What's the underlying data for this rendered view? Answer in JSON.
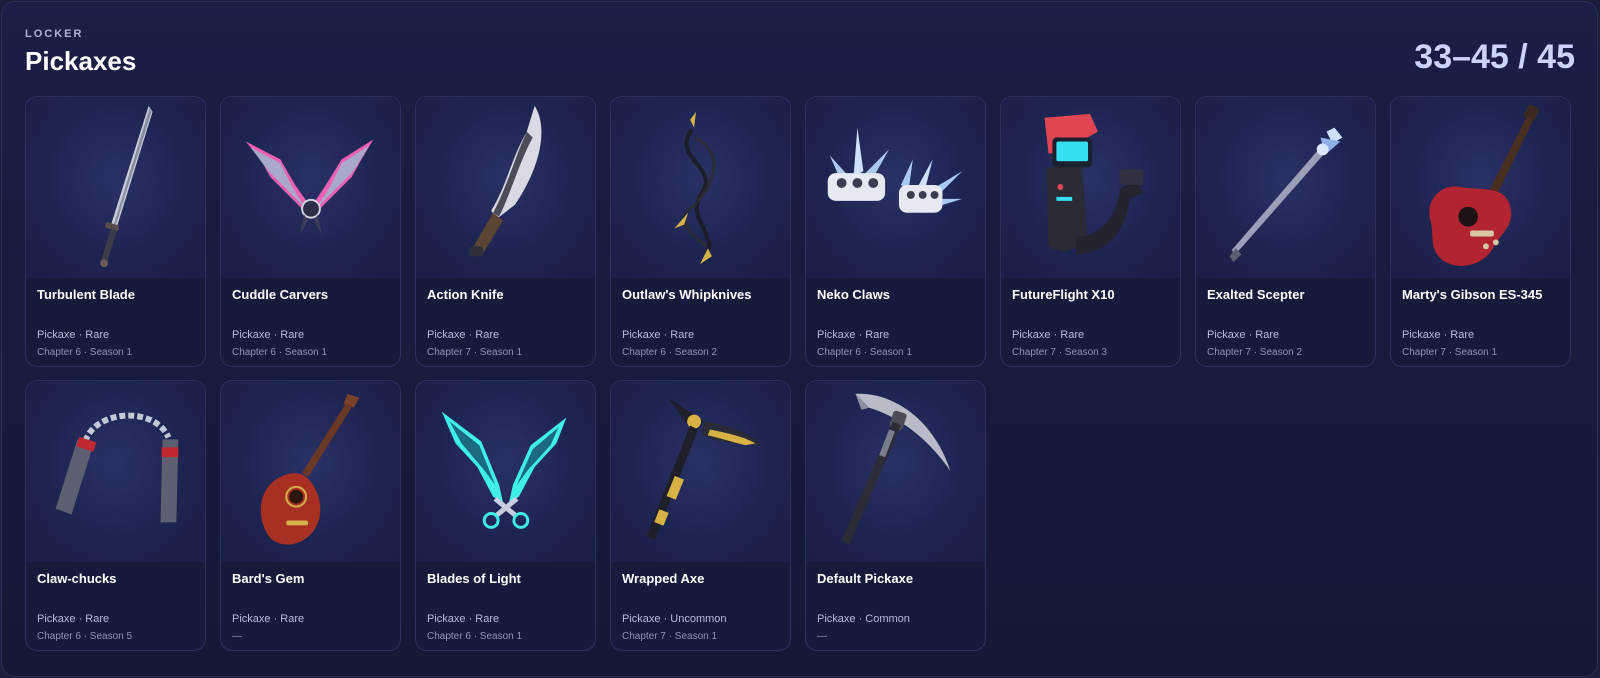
{
  "header": {
    "eyebrow": "LOCKER",
    "title": "Pickaxes",
    "counter": "33–45 / 45"
  },
  "items": [
    {
      "name": "Turbulent Blade",
      "meta": "Pickaxe · Rare",
      "season": "Chapter 6 · Season 1",
      "icon": "katana-icon"
    },
    {
      "name": "Cuddle Carvers",
      "meta": "Pickaxe · Rare",
      "season": "Chapter 6 · Season 1",
      "icon": "pink-wing-blades-icon"
    },
    {
      "name": "Action Knife",
      "meta": "Pickaxe · Rare",
      "season": "Chapter 7 · Season 1",
      "icon": "machete-icon"
    },
    {
      "name": "Outlaw's Whipknives",
      "meta": "Pickaxe · Rare",
      "season": "Chapter 6 · Season 2",
      "icon": "whip-knives-icon"
    },
    {
      "name": "Neko Claws",
      "meta": "Pickaxe · Rare",
      "season": "Chapter 6 · Season 1",
      "icon": "claws-icon"
    },
    {
      "name": "FutureFlight X10",
      "meta": "Pickaxe · Rare",
      "season": "Chapter 7 · Season 3",
      "icon": "futuristic-controller-icon"
    },
    {
      "name": "Exalted Scepter",
      "meta": "Pickaxe · Rare",
      "season": "Chapter 7 · Season 2",
      "icon": "scepter-icon"
    },
    {
      "name": "Marty's Gibson ES-345",
      "meta": "Pickaxe · Rare",
      "season": "Chapter 7 · Season 1",
      "icon": "guitar-icon"
    },
    {
      "name": "Claw-chucks",
      "meta": "Pickaxe · Rare",
      "season": "Chapter 6 · Season 5",
      "icon": "nunchucks-icon"
    },
    {
      "name": "Bard's Gem",
      "meta": "Pickaxe · Rare",
      "season": "—",
      "icon": "lute-icon"
    },
    {
      "name": "Blades of Light",
      "meta": "Pickaxe · Rare",
      "season": "Chapter 6 · Season 1",
      "icon": "light-blades-icon"
    },
    {
      "name": "Wrapped Axe",
      "meta": "Pickaxe · Uncommon",
      "season": "Chapter 7 · Season 1",
      "icon": "wrapped-axe-icon"
    },
    {
      "name": "Default Pickaxe",
      "meta": "Pickaxe · Common",
      "season": "—",
      "icon": "pickaxe-icon"
    }
  ]
}
